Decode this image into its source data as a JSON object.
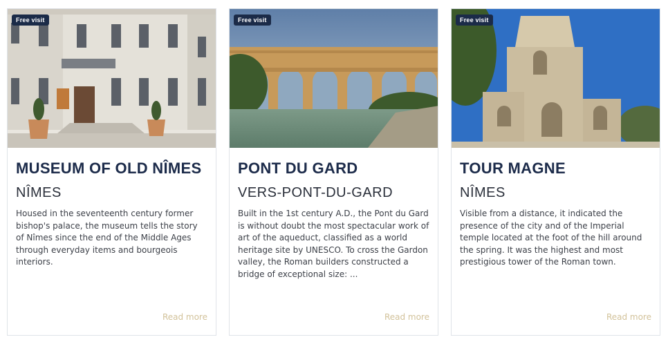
{
  "cards": [
    {
      "badge": "Free visit",
      "title": "MUSEUM OF OLD NÎMES",
      "city": "NÎMES",
      "description": "Housed in the seventeenth century former bishop's palace, the museum tells the story of Nîmes since the end of the Middle Ages through everyday items and bourgeois interiors.",
      "read_more": "Read more"
    },
    {
      "badge": "Free visit",
      "title": "PONT DU GARD",
      "city": "VERS-PONT-DU-GARD",
      "description": "Built in the 1st century A.D., the Pont du Gard is without doubt the most spectacular work of art of the aqueduct, classified as a world heritage site by UNESCO. To cross the Gardon valley, the Roman builders constructed a bridge of exceptional size: ...",
      "read_more": "Read more"
    },
    {
      "badge": "Free visit",
      "title": "TOUR MAGNE",
      "city": "NÎMES",
      "description": "Visible from a distance, it indicated the presence of the city and of the Imperial temple located at the foot of the hill around the spring. It was the highest and most prestigious tower of the Roman town.",
      "read_more": "Read more"
    }
  ]
}
